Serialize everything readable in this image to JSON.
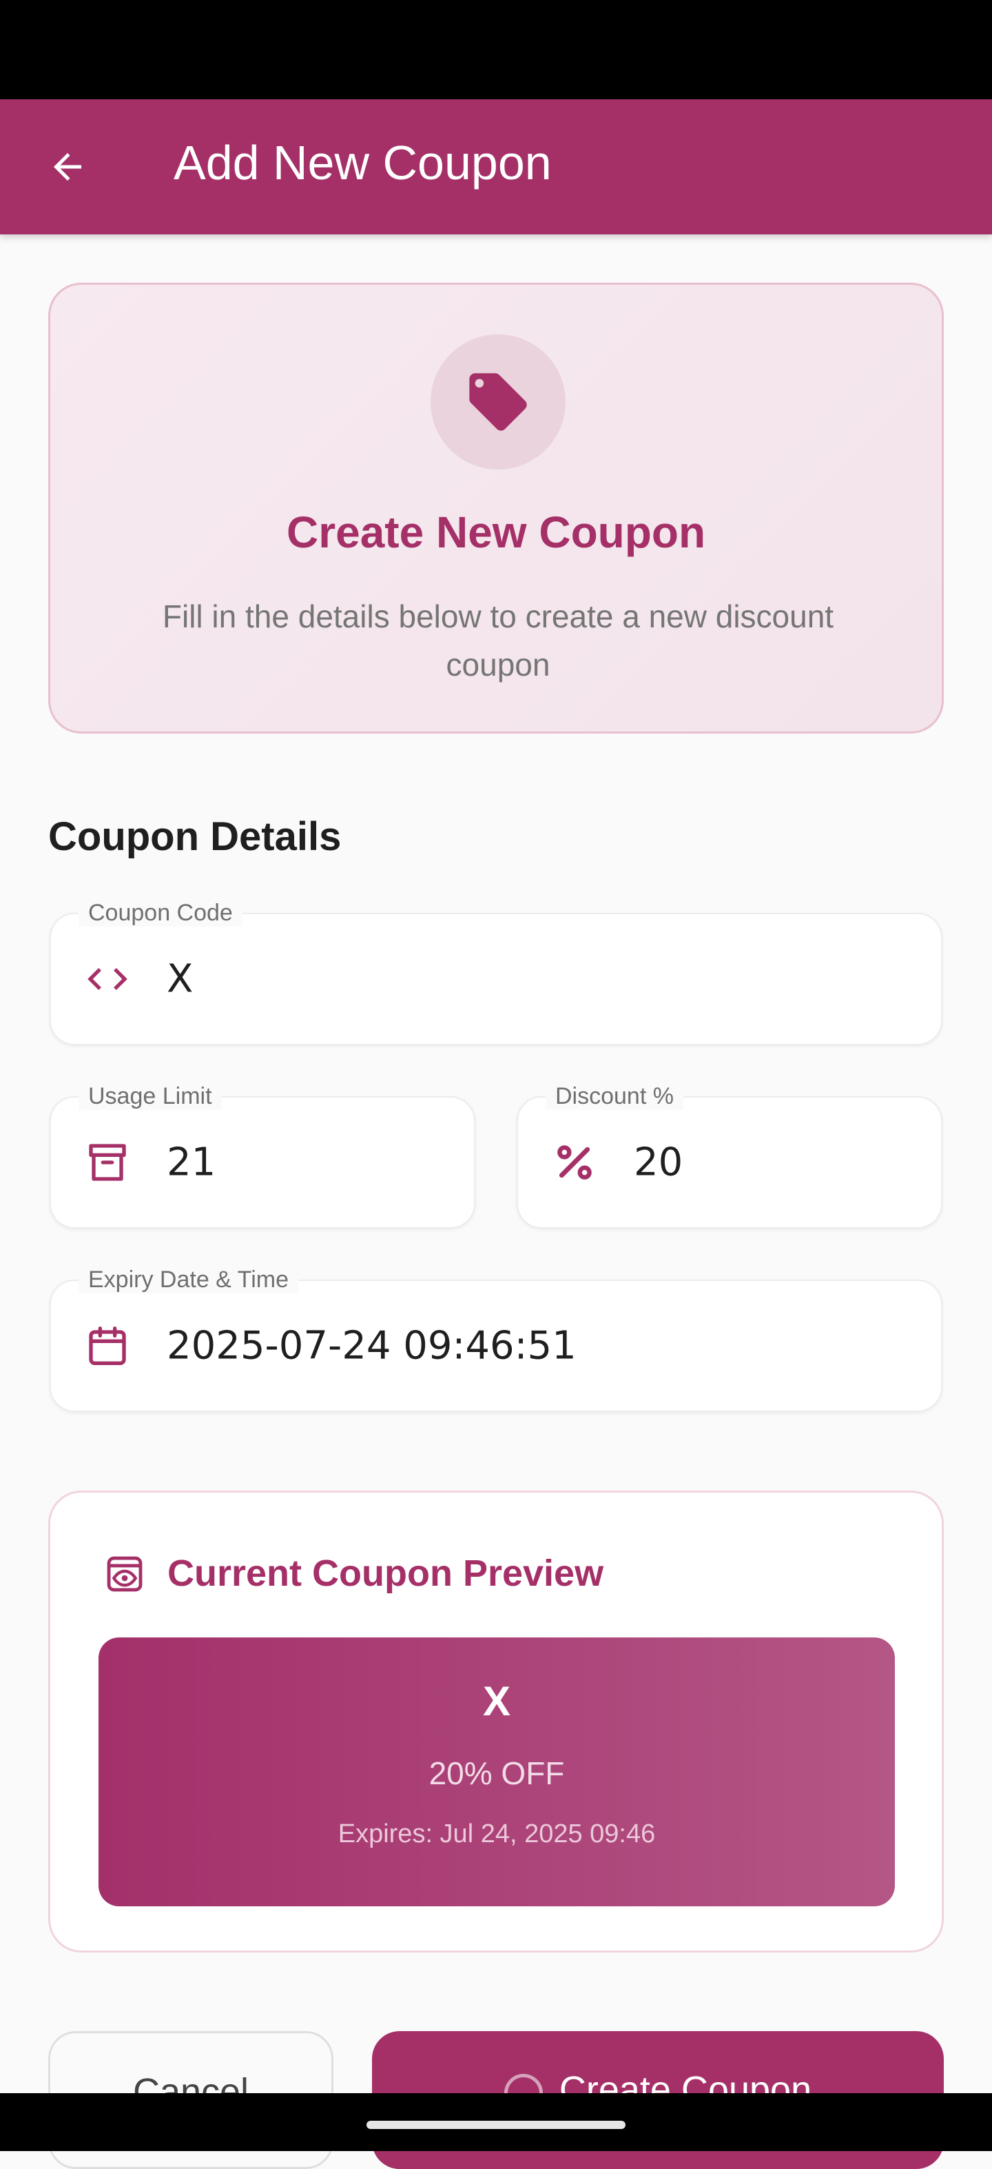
{
  "app_bar": {
    "title": "Add New Coupon",
    "back_icon": "arrow-back-icon"
  },
  "hero": {
    "icon": "tag-icon",
    "title": "Create New Coupon",
    "subtitle": "Fill in the details below to create a new discount coupon"
  },
  "section": {
    "title": "Coupon Details"
  },
  "fields": {
    "coupon_code": {
      "label": "Coupon Code",
      "value": "X",
      "icon": "code-brackets-icon"
    },
    "usage_limit": {
      "label": "Usage Limit",
      "value": "21",
      "icon": "archive-box-icon"
    },
    "discount": {
      "label": "Discount %",
      "value": "20",
      "icon": "percent-icon"
    },
    "expiry": {
      "label": "Expiry Date & Time",
      "value": "2025-07-24 09:46:51",
      "icon": "calendar-icon"
    }
  },
  "preview": {
    "heading": "Current Coupon Preview",
    "icon": "preview-eye-icon",
    "code": "X",
    "discount_text": "20% OFF",
    "expires_text": "Expires: Jul 24, 2025 09:46"
  },
  "actions": {
    "cancel_label": "Cancel",
    "create_label": "Create Coupon"
  },
  "colors": {
    "primary": "#a53068",
    "background": "#fafafa",
    "hero_bg": "#f4e6ec"
  }
}
